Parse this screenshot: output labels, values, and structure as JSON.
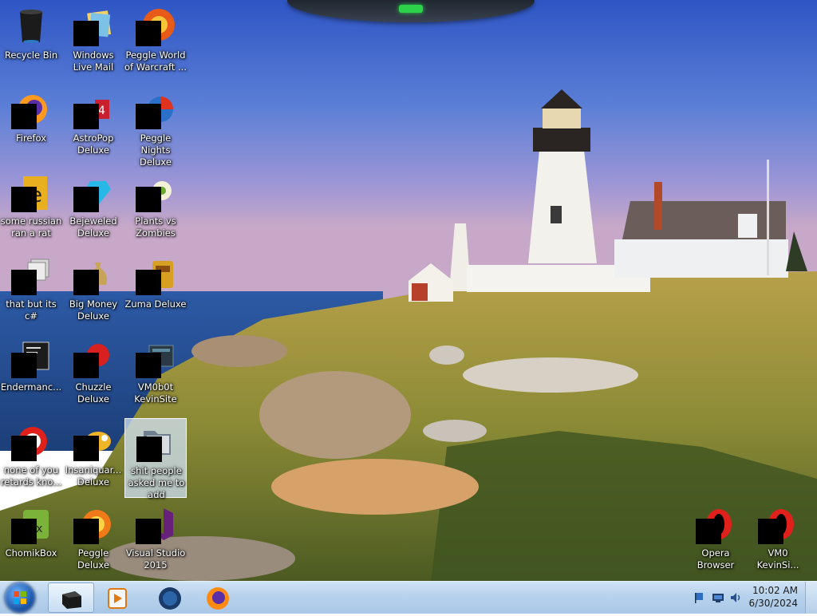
{
  "desktop": {
    "icons": [
      {
        "label": "Recycle Bin"
      },
      {
        "label": "Windows Live Mail"
      },
      {
        "label": "Peggle World of Warcraft ..."
      },
      {
        "label": "Firefox"
      },
      {
        "label": "AstroPop Deluxe"
      },
      {
        "label": "Peggle Nights Deluxe"
      },
      {
        "label": "some russian ran a rat"
      },
      {
        "label": "Bejeweled Deluxe"
      },
      {
        "label": "Plants vs Zombies"
      },
      {
        "label": "that but its c#"
      },
      {
        "label": "Big Money Deluxe"
      },
      {
        "label": "Zuma Deluxe"
      },
      {
        "label": "Endermanc..."
      },
      {
        "label": "Chuzzle Deluxe"
      },
      {
        "label": "VM0b0t KevinSite"
      },
      {
        "label": "none of you retards kno..."
      },
      {
        "label": "Insaniquar... Deluxe"
      },
      {
        "label": "shit people asked me to add"
      },
      {
        "label": "ChomikBox"
      },
      {
        "label": "Peggle Deluxe"
      },
      {
        "label": "Visual Studio 2015"
      },
      {
        "label": "Opera Browser"
      },
      {
        "label": "VM0 KevinSi..."
      }
    ]
  },
  "taskbar": {
    "start_icon": "windows-start-orb-icon",
    "pinned": [
      {
        "name": "file-explorer-icon"
      },
      {
        "name": "media-player-icon"
      },
      {
        "name": "globe-browser-icon"
      },
      {
        "name": "firefox-icon"
      }
    ],
    "tray_icons": [
      "flag-icon",
      "network-monitor-icon",
      "volume-icon"
    ],
    "clock": {
      "time": "10:02 AM",
      "date": "6/30/2024"
    }
  }
}
